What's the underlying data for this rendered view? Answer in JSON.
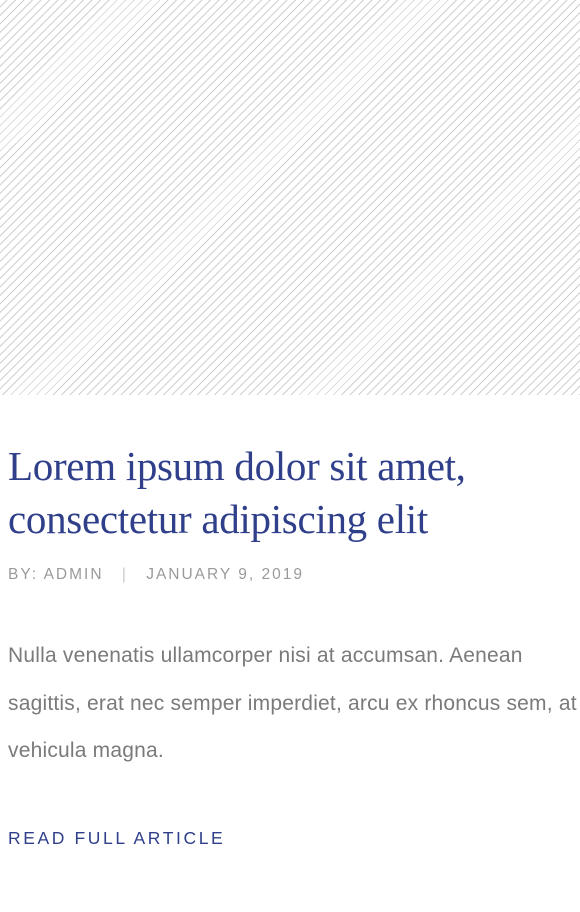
{
  "post": {
    "title": "Lorem ipsum dolor sit amet, consectetur adipiscing elit",
    "meta": {
      "author_label": "BY:",
      "author": "ADMIN",
      "separator": "|",
      "date": "JANUARY 9, 2019"
    },
    "excerpt": "Nulla venenatis ullamcorper nisi at accumsan. Aenean sagittis, erat nec semper imperdiet, arcu ex rhoncus sem, at vehicula magna.",
    "read_more_label": "READ FULL ARTICLE"
  },
  "colors": {
    "accent": "#2f3f8a",
    "meta_text": "#9a9a9a",
    "body_text": "#7a7a7a",
    "placeholder_stripe": "#cfcfcf"
  }
}
